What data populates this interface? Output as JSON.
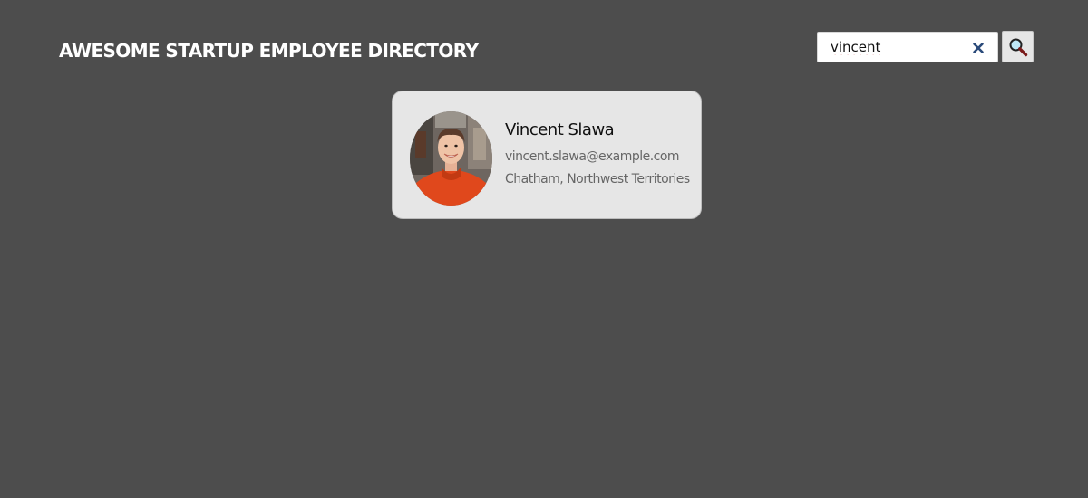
{
  "header": {
    "title": "AWESOME STARTUP EMPLOYEE DIRECTORY"
  },
  "search": {
    "value": "vincent",
    "clear_icon": "close-icon",
    "search_icon": "magnifier-icon"
  },
  "employees": [
    {
      "name": "Vincent Slawa",
      "email": "vincent.slawa@example.com",
      "location": "Chatham, Northwest Territories",
      "avatar_icon": "profile-photo"
    }
  ],
  "colors": {
    "background": "#4d4d4d",
    "card": "#e6e6e6",
    "accent": "#2a4a7a"
  }
}
